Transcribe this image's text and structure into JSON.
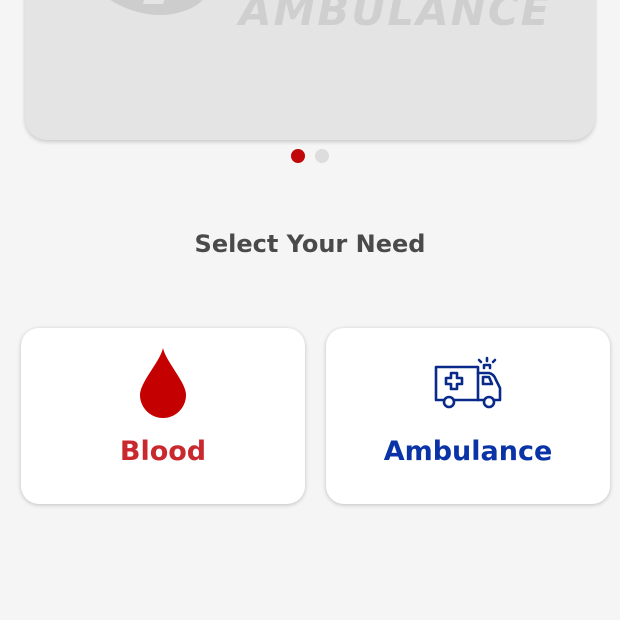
{
  "banner": {
    "text": "AMBULANCE"
  },
  "carousel": {
    "slide_count": 2,
    "active_index": 0
  },
  "heading": "Select Your Need",
  "options": [
    {
      "label": "Blood",
      "icon": "blood-drop-icon",
      "color": "#c8282e"
    },
    {
      "label": "Ambulance",
      "icon": "ambulance-icon",
      "color": "#0a33a8"
    }
  ],
  "colors": {
    "background": "#f5f5f5",
    "active_dot": "#c0070a",
    "inactive_dot": "#dddddd",
    "blood_drop": "#c40000",
    "ambulance_icon": "#0a2a8a"
  }
}
